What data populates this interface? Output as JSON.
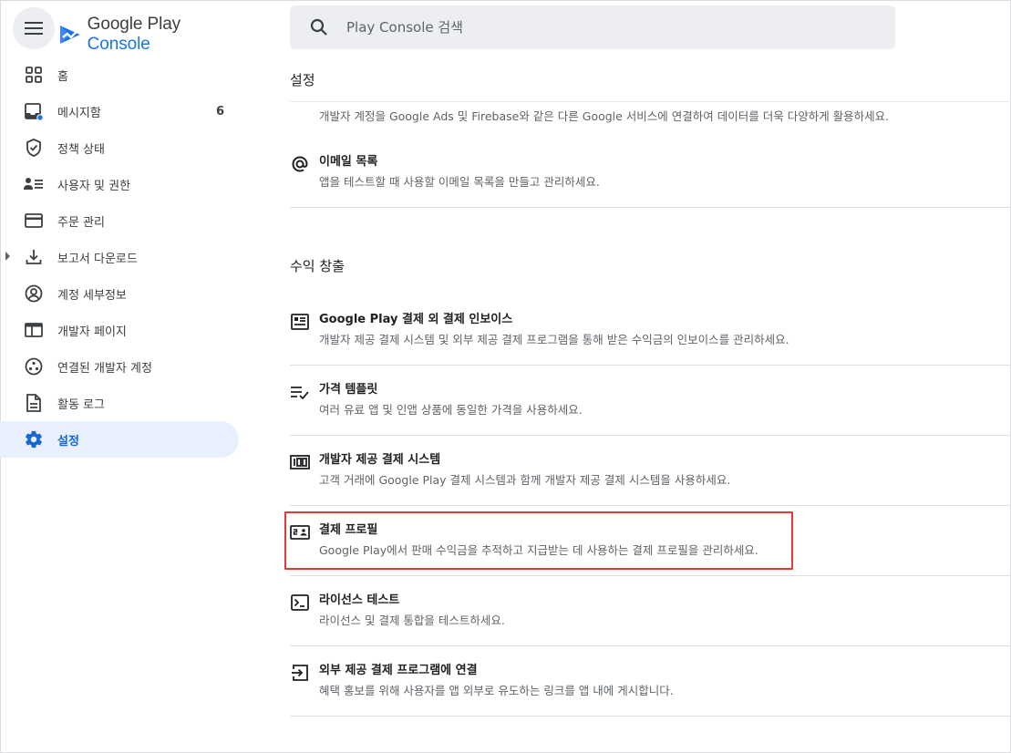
{
  "brand": {
    "name_part1": "Google Play ",
    "name_part2": "Console"
  },
  "search": {
    "placeholder": "Play Console 검색"
  },
  "sidebar": {
    "items": [
      {
        "label": "홈",
        "icon": "grid-icon"
      },
      {
        "label": "메시지함",
        "icon": "inbox-icon",
        "badge": "6"
      },
      {
        "label": "정책 상태",
        "icon": "shield-check-icon"
      },
      {
        "label": "사용자 및 권한",
        "icon": "users-permissions-icon"
      },
      {
        "label": "주문 관리",
        "icon": "credit-card-icon"
      },
      {
        "label": "보고서 다운로드",
        "icon": "download-icon"
      },
      {
        "label": "계정 세부정보",
        "icon": "account-circle-icon"
      },
      {
        "label": "개발자 페이지",
        "icon": "web-page-icon"
      },
      {
        "label": "연결된 개발자 계정",
        "icon": "linked-accounts-icon"
      },
      {
        "label": "활동 로그",
        "icon": "document-icon"
      },
      {
        "label": "설정",
        "icon": "gear-icon"
      }
    ]
  },
  "main": {
    "page_title": "설정",
    "partial_row_desc": "개발자 계정을 Google Ads 및 Firebase와 같은 다른 Google 서비스에 연결하여 데이터를 더욱 다양하게 활용하세요.",
    "email_row": {
      "title": "이메일 목록",
      "desc": "앱을 테스트할 때 사용할 이메일 목록을 만들고 관리하세요.",
      "icon": "at-sign-icon"
    },
    "monetization_title": "수익 창출",
    "monetization_rows": [
      {
        "title": "Google Play 결제 외 결제 인보이스",
        "desc": "개발자 제공 결제 시스템 및 외부 제공 결제 프로그램을 통해 받은 수익금의 인보이스를 관리하세요.",
        "icon": "invoice-icon"
      },
      {
        "title": "가격 템플릿",
        "desc": "여러 유료 앱 및 인앱 상품에 동일한 가격을 사용하세요.",
        "icon": "list-check-icon"
      },
      {
        "title": "개발자 제공 결제 시스템",
        "desc": "고객 거래에 Google Play 결제 시스템과 함께 개발자 제공 결제 시스템을 사용하세요.",
        "icon": "pin-icon"
      },
      {
        "title": "결제 프로필",
        "desc": "Google Play에서 판매 수익금을 추적하고 지급받는 데 사용하는 결제 프로필을 관리하세요.",
        "icon": "payment-profile-icon"
      },
      {
        "title": "라이선스 테스트",
        "desc": "라이선스 및 결제 통합을 테스트하세요.",
        "icon": "terminal-icon"
      },
      {
        "title": "외부 제공 결제 프로그램에 연결",
        "desc": "혜택 홍보를 위해 사용자를 앱 외부로 유도하는 링크를 앱 내에 게시합니다.",
        "icon": "login-arrow-icon"
      }
    ]
  },
  "colors": {
    "accent": "#1a73e8",
    "active_bg": "#e8f0fe",
    "highlight": "#e53935"
  }
}
